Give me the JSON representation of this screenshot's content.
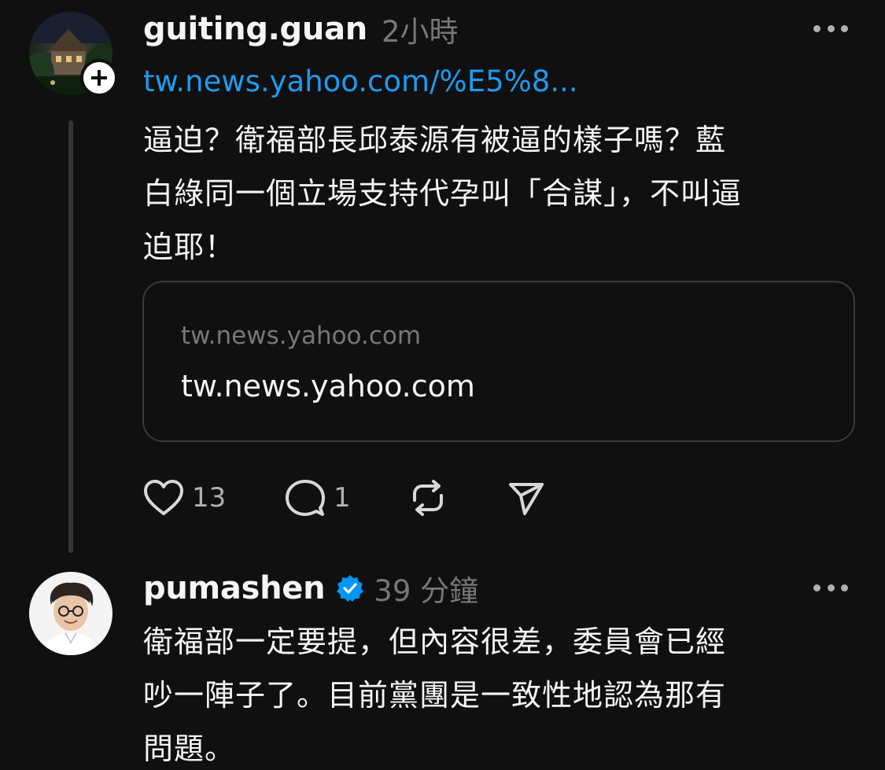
{
  "posts": [
    {
      "username": "guiting.guan",
      "timestamp": "2小時",
      "link": "tw.news.yahoo.com/%E5%8...",
      "body_lines": [
        "逼迫？衛福部長邱泰源有被逼的樣子嗎？藍",
        "白綠同一個立場支持代孕叫「合謀」，不叫逼",
        "迫耶！"
      ],
      "card": {
        "domain": "tw.news.yahoo.com",
        "title": "tw.news.yahoo.com"
      },
      "actions": {
        "like_count": "13",
        "reply_count": "1"
      },
      "icons": {
        "follow": "plus-icon",
        "more": "more-icon",
        "like": "heart-icon",
        "reply": "comment-icon",
        "repost": "repost-icon",
        "share": "send-icon"
      }
    },
    {
      "username": "pumashen",
      "verified": true,
      "timestamp": "39 分鐘",
      "body_lines": [
        "衛福部一定要提，但內容很差，委員會已經",
        "吵一陣子了。目前黨團是一致性地認為那有",
        "問題。"
      ],
      "icons": {
        "verified": "verified-badge-icon",
        "more": "more-icon"
      }
    }
  ],
  "colors": {
    "background": "#101010",
    "text": "#f3f5f7",
    "muted": "#777777",
    "link": "#1d9bf0",
    "verified": "#0095f6"
  }
}
